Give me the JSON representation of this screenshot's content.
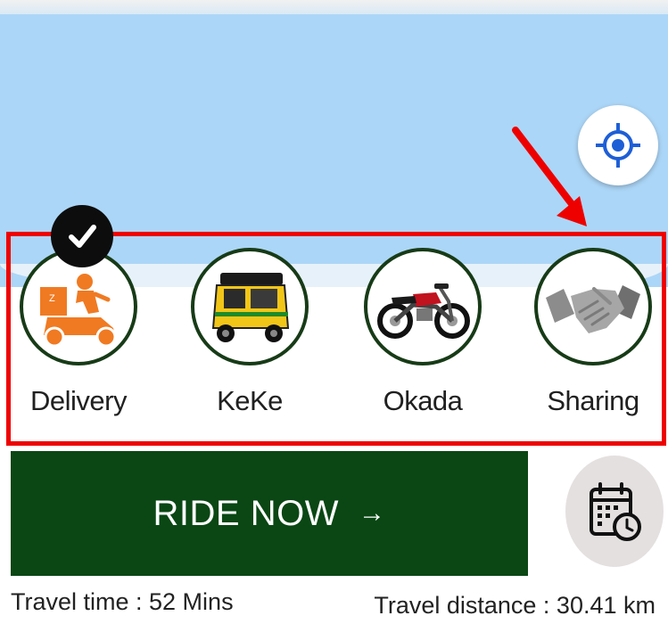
{
  "vehicles": [
    {
      "label": "Delivery",
      "icon": "delivery-scooter-icon",
      "selected": true
    },
    {
      "label": "KeKe",
      "icon": "tricycle-icon",
      "selected": false
    },
    {
      "label": "Okada",
      "icon": "motorcycle-icon",
      "selected": false
    },
    {
      "label": "Sharing",
      "icon": "handshake-icon",
      "selected": false
    }
  ],
  "ride_button": {
    "label": "RIDE NOW",
    "arrow": "→"
  },
  "schedule_button": {
    "icon": "calendar-clock-icon"
  },
  "locate_button": {
    "icon": "locate-icon"
  },
  "trip": {
    "travel_time": "Travel time : 52 Mins",
    "travel_distance": "Travel distance : 30.41 km"
  },
  "colors": {
    "map_water": "#acd6f7",
    "ride_button": "#0a4714",
    "annotation": "#ee0000",
    "locate_icon": "#1e5fd6",
    "delivery_icon": "#f07a22"
  }
}
